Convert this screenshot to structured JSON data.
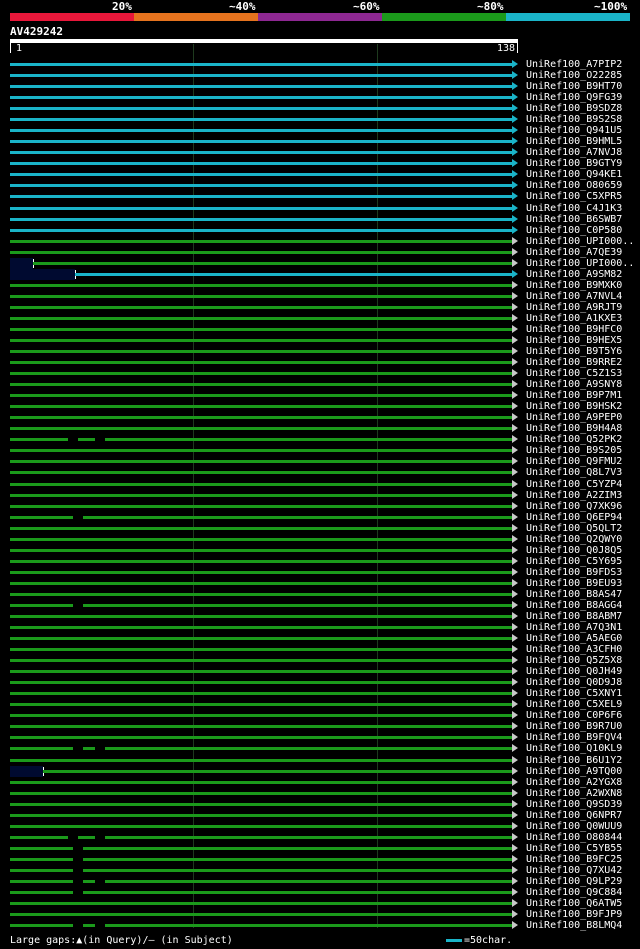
{
  "legend": {
    "labels": [
      "20%",
      "~40%",
      "~60%",
      "~80%",
      "~100%"
    ],
    "colors": [
      "#e8173a",
      "#e5731e",
      "#8e2892",
      "#1b9a1b",
      "#1ab4c8"
    ]
  },
  "query": {
    "name": "AV429242",
    "start": "1",
    "end": "138"
  },
  "hits": [
    {
      "name": "UniRef100_A7PIP2",
      "color": "cyan"
    },
    {
      "name": "UniRef100_O22285",
      "color": "cyan"
    },
    {
      "name": "UniRef100_B9HT70",
      "color": "cyan"
    },
    {
      "name": "UniRef100_Q9FG39",
      "color": "cyan"
    },
    {
      "name": "UniRef100_B9SDZ8",
      "color": "cyan"
    },
    {
      "name": "UniRef100_B9S2S8",
      "color": "cyan"
    },
    {
      "name": "UniRef100_Q941U5",
      "color": "cyan"
    },
    {
      "name": "UniRef100_B9HML5",
      "color": "cyan"
    },
    {
      "name": "UniRef100_A7NVJ8",
      "color": "cyan"
    },
    {
      "name": "UniRef100_B9GTY9",
      "color": "cyan"
    },
    {
      "name": "UniRef100_Q94KE1",
      "color": "cyan"
    },
    {
      "name": "UniRef100_O80659",
      "color": "cyan"
    },
    {
      "name": "UniRef100_C5XPR5",
      "color": "cyan"
    },
    {
      "name": "UniRef100_C4J1K3",
      "color": "cyan"
    },
    {
      "name": "UniRef100_B6SWB7",
      "color": "cyan"
    },
    {
      "name": "UniRef100_C0P580",
      "color": "cyan"
    },
    {
      "name": "UniRef100_UPI000..",
      "color": "green"
    },
    {
      "name": "UniRef100_A7QE39",
      "color": "green"
    },
    {
      "name": "UniRef100_UPI000..",
      "color": "green",
      "qgap": true,
      "startFrac": 0.045
    },
    {
      "name": "UniRef100_A9SM82",
      "color": "cyan",
      "qgap": true,
      "startFrac": 0.13
    },
    {
      "name": "UniRef100_B9MXK0",
      "color": "green"
    },
    {
      "name": "UniRef100_A7NVL4",
      "color": "green"
    },
    {
      "name": "UniRef100_A9RJT9",
      "color": "green"
    },
    {
      "name": "UniRef100_A1KXE3",
      "color": "green"
    },
    {
      "name": "UniRef100_B9HFC0",
      "color": "green"
    },
    {
      "name": "UniRef100_B9HEX5",
      "color": "green"
    },
    {
      "name": "UniRef100_B9T5Y6",
      "color": "green"
    },
    {
      "name": "UniRef100_B9RRE2",
      "color": "green"
    },
    {
      "name": "UniRef100_C5Z1S3",
      "color": "green"
    },
    {
      "name": "UniRef100_A9SNY8",
      "color": "green"
    },
    {
      "name": "UniRef100_B9P7M1",
      "color": "green"
    },
    {
      "name": "UniRef100_B9HSK2",
      "color": "green"
    },
    {
      "name": "UniRef100_A9PEP0",
      "color": "green"
    },
    {
      "name": "UniRef100_B9H4A8",
      "color": "green"
    },
    {
      "name": "UniRef100_Q52PK2",
      "color": "green",
      "gaps": [
        0.115,
        0.17
      ]
    },
    {
      "name": "UniRef100_B9S205",
      "color": "green"
    },
    {
      "name": "UniRef100_Q9FMU2",
      "color": "green"
    },
    {
      "name": "UniRef100_Q8L7V3",
      "color": "green"
    },
    {
      "name": "UniRef100_C5YZP4",
      "color": "green"
    },
    {
      "name": "UniRef100_A2ZIM3",
      "color": "green"
    },
    {
      "name": "UniRef100_Q7XK96",
      "color": "green"
    },
    {
      "name": "UniRef100_Q6EP94",
      "color": "green",
      "gaps": [
        0.125
      ]
    },
    {
      "name": "UniRef100_Q5QLT2",
      "color": "green"
    },
    {
      "name": "UniRef100_Q2QWY0",
      "color": "green"
    },
    {
      "name": "UniRef100_Q0J8Q5",
      "color": "green"
    },
    {
      "name": "UniRef100_C5Y695",
      "color": "green"
    },
    {
      "name": "UniRef100_B9FDS3",
      "color": "green"
    },
    {
      "name": "UniRef100_B9EU93",
      "color": "green"
    },
    {
      "name": "UniRef100_B8AS47",
      "color": "green"
    },
    {
      "name": "UniRef100_B8AGG4",
      "color": "green",
      "gaps": [
        0.125
      ]
    },
    {
      "name": "UniRef100_B8ABM7",
      "color": "green"
    },
    {
      "name": "UniRef100_A7Q3N1",
      "color": "green"
    },
    {
      "name": "UniRef100_A5AEG0",
      "color": "green"
    },
    {
      "name": "UniRef100_A3CFH0",
      "color": "green"
    },
    {
      "name": "UniRef100_Q5Z5X8",
      "color": "green"
    },
    {
      "name": "UniRef100_Q0JH49",
      "color": "green"
    },
    {
      "name": "UniRef100_Q0D9J8",
      "color": "green"
    },
    {
      "name": "UniRef100_C5XNY1",
      "color": "green"
    },
    {
      "name": "UniRef100_C5XEL9",
      "color": "green"
    },
    {
      "name": "UniRef100_C0P6F6",
      "color": "green"
    },
    {
      "name": "UniRef100_B9R7U0",
      "color": "green"
    },
    {
      "name": "UniRef100_B9FQV4",
      "color": "green"
    },
    {
      "name": "UniRef100_Q10KL9",
      "color": "green",
      "gaps": [
        0.125,
        0.17
      ]
    },
    {
      "name": "UniRef100_B6U1Y2",
      "color": "green"
    },
    {
      "name": "UniRef100_A9TQ00",
      "color": "green",
      "qgap": true,
      "startFrac": 0.065
    },
    {
      "name": "UniRef100_A2YGX8",
      "color": "green"
    },
    {
      "name": "UniRef100_A2WXN8",
      "color": "green"
    },
    {
      "name": "UniRef100_Q9SD39",
      "color": "green"
    },
    {
      "name": "UniRef100_Q6NPR7",
      "color": "green"
    },
    {
      "name": "UniRef100_Q0WUU9",
      "color": "green"
    },
    {
      "name": "UniRef100_O80844",
      "color": "green",
      "gaps": [
        0.115,
        0.17
      ]
    },
    {
      "name": "UniRef100_C5YB55",
      "color": "green",
      "gaps": [
        0.125
      ]
    },
    {
      "name": "UniRef100_B9FC25",
      "color": "green",
      "gaps": [
        0.125
      ]
    },
    {
      "name": "UniRef100_Q7XU42",
      "color": "green",
      "gaps": [
        0.125
      ]
    },
    {
      "name": "UniRef100_Q9LP29",
      "color": "green",
      "gaps": [
        0.125,
        0.17
      ]
    },
    {
      "name": "UniRef100_Q9C884",
      "color": "green",
      "gaps": [
        0.125
      ]
    },
    {
      "name": "UniRef100_Q6ATW5",
      "color": "green"
    },
    {
      "name": "UniRef100_B9FJP9",
      "color": "green"
    },
    {
      "name": "UniRef100_B8LMQ4",
      "color": "green",
      "gaps": [
        0.125,
        0.17
      ]
    }
  ],
  "footer": {
    "large_gaps": "Large gaps:▲(in Query)/— (in Subject)",
    "scale": "=50char."
  },
  "colors": {
    "cyan": "#1ab4c8",
    "green": "#1b9a1b",
    "arrow": "#c8c8c8"
  }
}
